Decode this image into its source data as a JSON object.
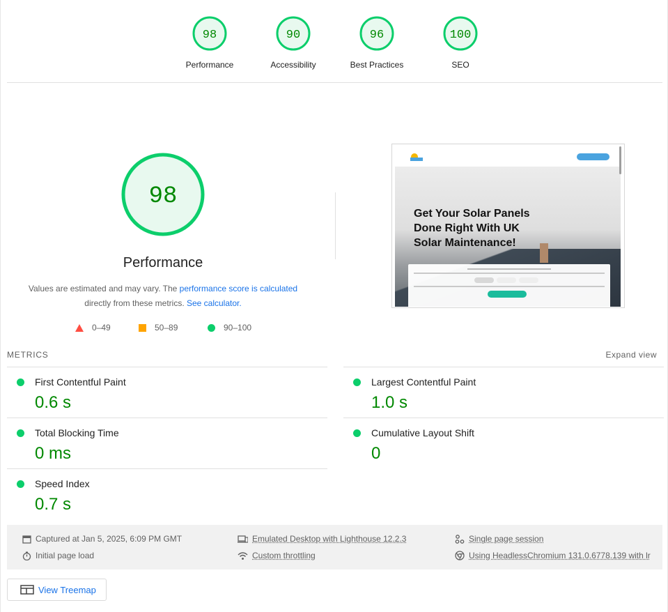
{
  "scores": [
    {
      "label": "Performance",
      "value": "98"
    },
    {
      "label": "Accessibility",
      "value": "90"
    },
    {
      "label": "Best Practices",
      "value": "96"
    },
    {
      "label": "SEO",
      "value": "100"
    }
  ],
  "main": {
    "score": "98",
    "title": "Performance",
    "desc_prefix": "Values are estimated and may vary. The ",
    "desc_link1": "performance score is calculated",
    "desc_middle": "directly from these metrics. ",
    "desc_link2": "See calculator."
  },
  "legend": [
    {
      "label": "0–49",
      "color": "#ff4e42",
      "shape": "triangle"
    },
    {
      "label": "50–89",
      "color": "#ffa400",
      "shape": "square"
    },
    {
      "label": "90–100",
      "color": "#0cce6b",
      "shape": "circle"
    }
  ],
  "screenshot": {
    "headline_line1": "Get Your Solar Panels",
    "headline_line2": "Done Right With UK",
    "headline_line3": "Solar Maintenance!"
  },
  "metrics": {
    "title": "METRICS",
    "expand_label": "Expand view",
    "items": [
      {
        "name": "First Contentful Paint",
        "value": "0.6 s"
      },
      {
        "name": "Largest Contentful Paint",
        "value": "1.0 s"
      },
      {
        "name": "Total Blocking Time",
        "value": "0 ms"
      },
      {
        "name": "Cumulative Layout Shift",
        "value": "0"
      },
      {
        "name": "Speed Index",
        "value": "0.7 s"
      }
    ]
  },
  "info": {
    "captured": "Captured at Jan 5, 2025, 6:09 PM GMT",
    "initial_load": "Initial page load",
    "emulated": "Emulated Desktop with Lighthouse 12.2.3",
    "throttling": "Custom throttling",
    "session": "Single page session",
    "browser": "Using HeadlessChromium 131.0.6778.139 with lr"
  },
  "treemap_label": "View Treemap",
  "colors": {
    "pass": "#0cce6b",
    "pass_text": "#008800",
    "link": "#1a73e8"
  }
}
